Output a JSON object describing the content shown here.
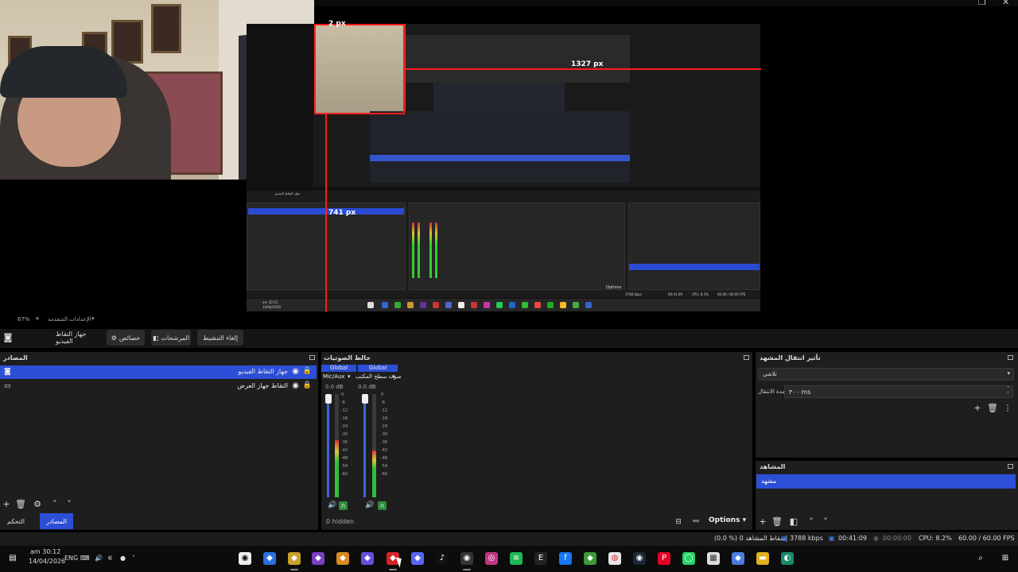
{
  "preview": {
    "measure_top": "2 px",
    "measure_right": "1327 px",
    "measure_bottom": "741 px",
    "nested_options": "Options",
    "nested_time": "00:41:09",
    "nested_kbps": "3788 kbps",
    "nested_cpu": "CPU: 8.2%",
    "nested_fps": "60.00 / 60.00 FPS",
    "nested_scene": "جهاز التقاط الفيديو",
    "nested_date_time": "am 30:12",
    "nested_date": "14/04/2026"
  },
  "preview_footer": {
    "zoom": "67%",
    "scene_label": "الإعدادات المتقدمة"
  },
  "scene_toolbar": {
    "source_name": "جهاز التقاط الفيديو",
    "properties": "خصائص",
    "filters": "المرشحات",
    "deactivate": "إلغاء التنشيط"
  },
  "sources": {
    "title": "المصادر",
    "items": [
      {
        "label": "جهاز التقاط الفيديو",
        "icon": "camera-icon",
        "selected": true
      },
      {
        "label": "التقاط جهاز العرض",
        "icon": "monitor-icon",
        "selected": false
      }
    ],
    "tabs": {
      "controls": "التحكم",
      "sources": "المصادر"
    }
  },
  "mixer": {
    "title": "خالط الصوتيات",
    "channels": [
      {
        "scope": "Global",
        "name": "Mic/Aux",
        "db": "0.0 dB",
        "level": 0.55
      },
      {
        "scope": "Global",
        "name": "صوت سطح المكتب",
        "db": "0.0 dB",
        "level": 0.45
      }
    ],
    "scale": [
      "0",
      "-6",
      "-12",
      "-18",
      "-24",
      "-30",
      "-36",
      "-42",
      "-48",
      "-54",
      "-60"
    ],
    "hidden": "0 hidden",
    "options": "Options"
  },
  "transitions": {
    "title": "تأثير انتقال المشهد",
    "selected": "تلاشي",
    "duration_label": "مدة الانتقال",
    "duration_value": "٣٠٠ ms"
  },
  "scenes": {
    "title": "المشاهد",
    "items": [
      "مشهد"
    ]
  },
  "status": {
    "kbps": "3788 kbps",
    "rec_time": "00:41:09",
    "stream_time": "00:00:00",
    "cpu": "CPU: 8.2%",
    "fps": "60.00 / 60.00 FPS",
    "dropped": "(0.0 %) 0 إسقاط المشاهد"
  },
  "taskbar": {
    "time": "am 30:12",
    "date": "14/04/2026",
    "lang": "ENG"
  },
  "colors": {
    "accent": "#2b4fd6",
    "measure": "#ff1a1a",
    "meter_green": "#2fbf3f",
    "meter_yellow": "#d4c63a",
    "meter_red": "#d33"
  }
}
